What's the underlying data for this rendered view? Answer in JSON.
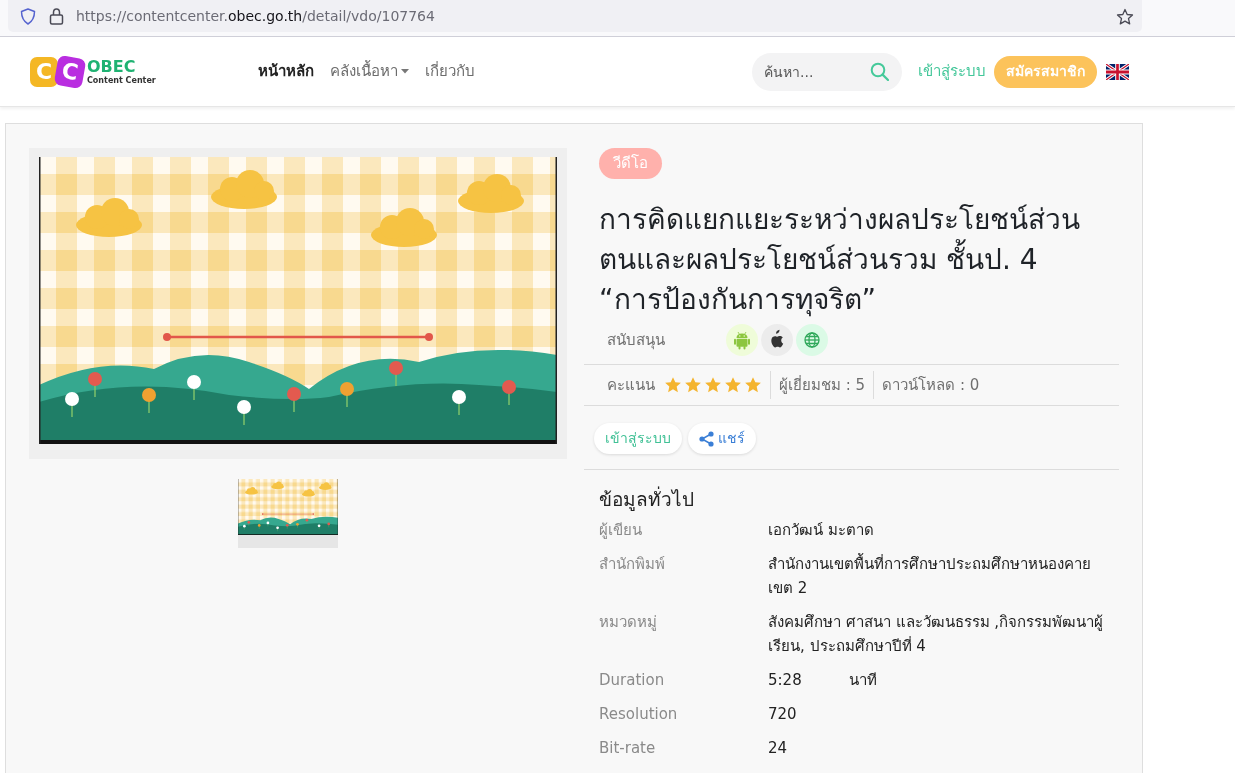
{
  "browser": {
    "url_prefix": "https://contentcenter.",
    "url_domain": "obec.go.th",
    "url_path": "/detail/vdo/107764"
  },
  "header": {
    "logo": {
      "letters": [
        "C",
        "C"
      ],
      "name": "OBEC",
      "tagline": "Content Center"
    },
    "nav": [
      {
        "label": "หน้าหลัก",
        "selected": true,
        "dropdown": false
      },
      {
        "label": "คลังเนื้อหา",
        "selected": false,
        "dropdown": true
      },
      {
        "label": "เกี่ยวกับ",
        "selected": false,
        "dropdown": false
      }
    ],
    "search": {
      "placeholder": "ค้นหา..."
    },
    "login": "เข้าสู่ระบบ",
    "register": "สมัครสมาชิก"
  },
  "detail": {
    "badge": "วีดีโอ",
    "title": "การคิดแยกแยะระหว่างผลประโยชน์ส่วนตนและผลประโยชน์ส่วนรวม ชั้นป. 4 “การป้องกันการทุจริต”",
    "support_label": "สนับสนุน",
    "platforms": [
      {
        "kind": "android"
      },
      {
        "kind": "apple"
      },
      {
        "kind": "web"
      }
    ],
    "rating_label": "คะแนน",
    "stars": 5,
    "views": "ผู้เยี่ยมชม : 5",
    "downloads": "ดาวน์โหลด : 0",
    "actions": [
      {
        "kind": "login",
        "label": "เข้าสู่ระบบ"
      },
      {
        "kind": "share",
        "label": "แชร์"
      }
    ]
  },
  "info": {
    "heading": "ข้อมูลทั่วไป",
    "rows": [
      {
        "label": "ผู้เขียน",
        "value": "เอกวัฒน์ มะตาด"
      },
      {
        "label": "สำนักพิมพ์",
        "value": "สำนักงานเขตพื้นที่การศึกษาประถมศึกษาหนองคาย เขต 2"
      },
      {
        "label": "หมวดหมู่",
        "value": "สังคมศึกษา ศาสนา และวัฒนธรรม ,กิจกรรมพัฒนาผู้เรียน, ประถมศึกษาปีที่ 4"
      },
      {
        "label": "Duration",
        "value": "5:28",
        "unit": "นาที"
      },
      {
        "label": "Resolution",
        "value": "720"
      },
      {
        "label": "Bit-rate",
        "value": "24"
      }
    ]
  }
}
